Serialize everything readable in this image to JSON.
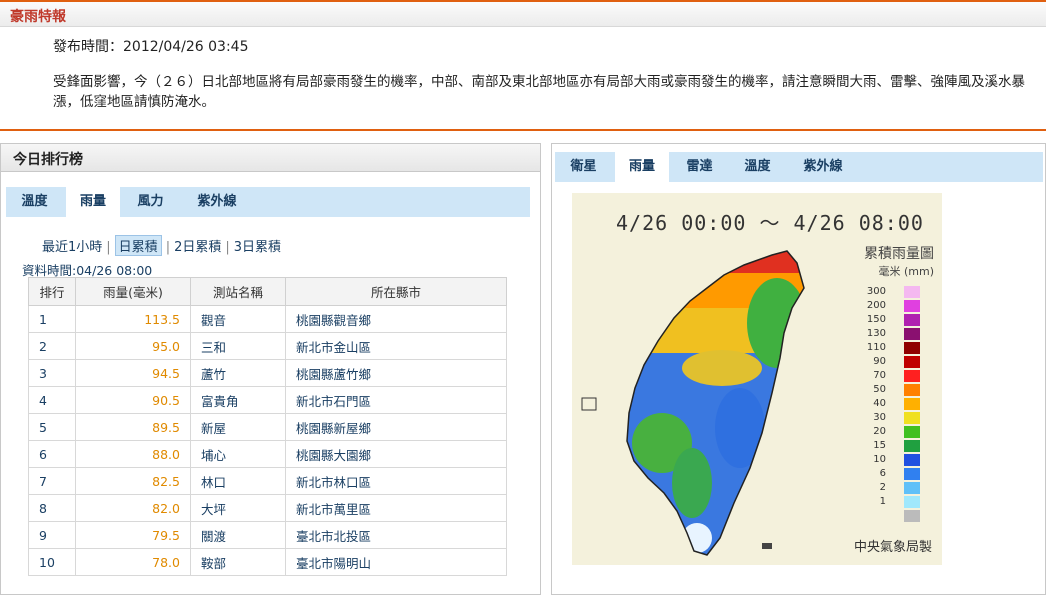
{
  "warning": {
    "title": "豪雨特報",
    "issue_time": "發布時間：2012/04/26 03:45",
    "text": "受鋒面影響，今（２６）日北部地區將有局部豪雨發生的機率，中部、南部及東北部地區亦有局部大雨或豪雨發生的機率，請注意瞬間大雨、雷擊、強陣風及溪水暴漲，低窪地區請慎防淹水。"
  },
  "ranking": {
    "title": "今日排行榜",
    "tabs": [
      "溫度",
      "雨量",
      "風力",
      "紫外線"
    ],
    "active_tab": "雨量",
    "subnav": [
      "最近1小時",
      "日累積",
      "2日累積",
      "3日累積"
    ],
    "active_subnav": "日累積",
    "data_time": "資料時間:04/26 08:00",
    "columns": [
      "排行",
      "雨量(毫米)",
      "測站名稱",
      "所在縣市"
    ],
    "rows": [
      {
        "rank": "1",
        "rain": "113.5",
        "station": "觀音",
        "city": "桃園縣觀音鄉"
      },
      {
        "rank": "2",
        "rain": "95.0",
        "station": "三和",
        "city": "新北市金山區"
      },
      {
        "rank": "3",
        "rain": "94.5",
        "station": "蘆竹",
        "city": "桃園縣蘆竹鄉"
      },
      {
        "rank": "4",
        "rain": "90.5",
        "station": "富貴角",
        "city": "新北市石門區"
      },
      {
        "rank": "5",
        "rain": "89.5",
        "station": "新屋",
        "city": "桃園縣新屋鄉"
      },
      {
        "rank": "6",
        "rain": "88.0",
        "station": "埔心",
        "city": "桃園縣大園鄉"
      },
      {
        "rank": "7",
        "rain": "82.5",
        "station": "林口",
        "city": "新北市林口區"
      },
      {
        "rank": "8",
        "rain": "82.0",
        "station": "大坪",
        "city": "新北市萬里區"
      },
      {
        "rank": "9",
        "rain": "79.5",
        "station": "關渡",
        "city": "臺北市北投區"
      },
      {
        "rank": "10",
        "rain": "78.0",
        "station": "鞍部",
        "city": "臺北市陽明山"
      }
    ]
  },
  "map_panel": {
    "tabs": [
      "衛星",
      "雨量",
      "雷達",
      "溫度",
      "紫外線"
    ],
    "active_tab": "雨量",
    "date_range": "4/26 00:00 ～ 4/26 08:00",
    "title": "累積雨量圖",
    "unit": "毫米 (mm)",
    "credit": "中央氣象局製",
    "legend": [
      {
        "label": "300",
        "color": "#f4b8f0"
      },
      {
        "label": "200",
        "color": "#e040e0"
      },
      {
        "label": "150",
        "color": "#b020b0"
      },
      {
        "label": "130",
        "color": "#8a1070"
      },
      {
        "label": "110",
        "color": "#900000"
      },
      {
        "label": "90",
        "color": "#c00000"
      },
      {
        "label": "70",
        "color": "#ff2020"
      },
      {
        "label": "50",
        "color": "#ff8000"
      },
      {
        "label": "40",
        "color": "#ffb000"
      },
      {
        "label": "30",
        "color": "#f0e020"
      },
      {
        "label": "20",
        "color": "#40c020"
      },
      {
        "label": "15",
        "color": "#20a040"
      },
      {
        "label": "10",
        "color": "#2050e0"
      },
      {
        "label": "6",
        "color": "#3080f0"
      },
      {
        "label": "2",
        "color": "#60c0f8"
      },
      {
        "label": "1",
        "color": "#a0e8fc"
      },
      {
        "label": "",
        "color": "#bbbbbb"
      }
    ]
  }
}
